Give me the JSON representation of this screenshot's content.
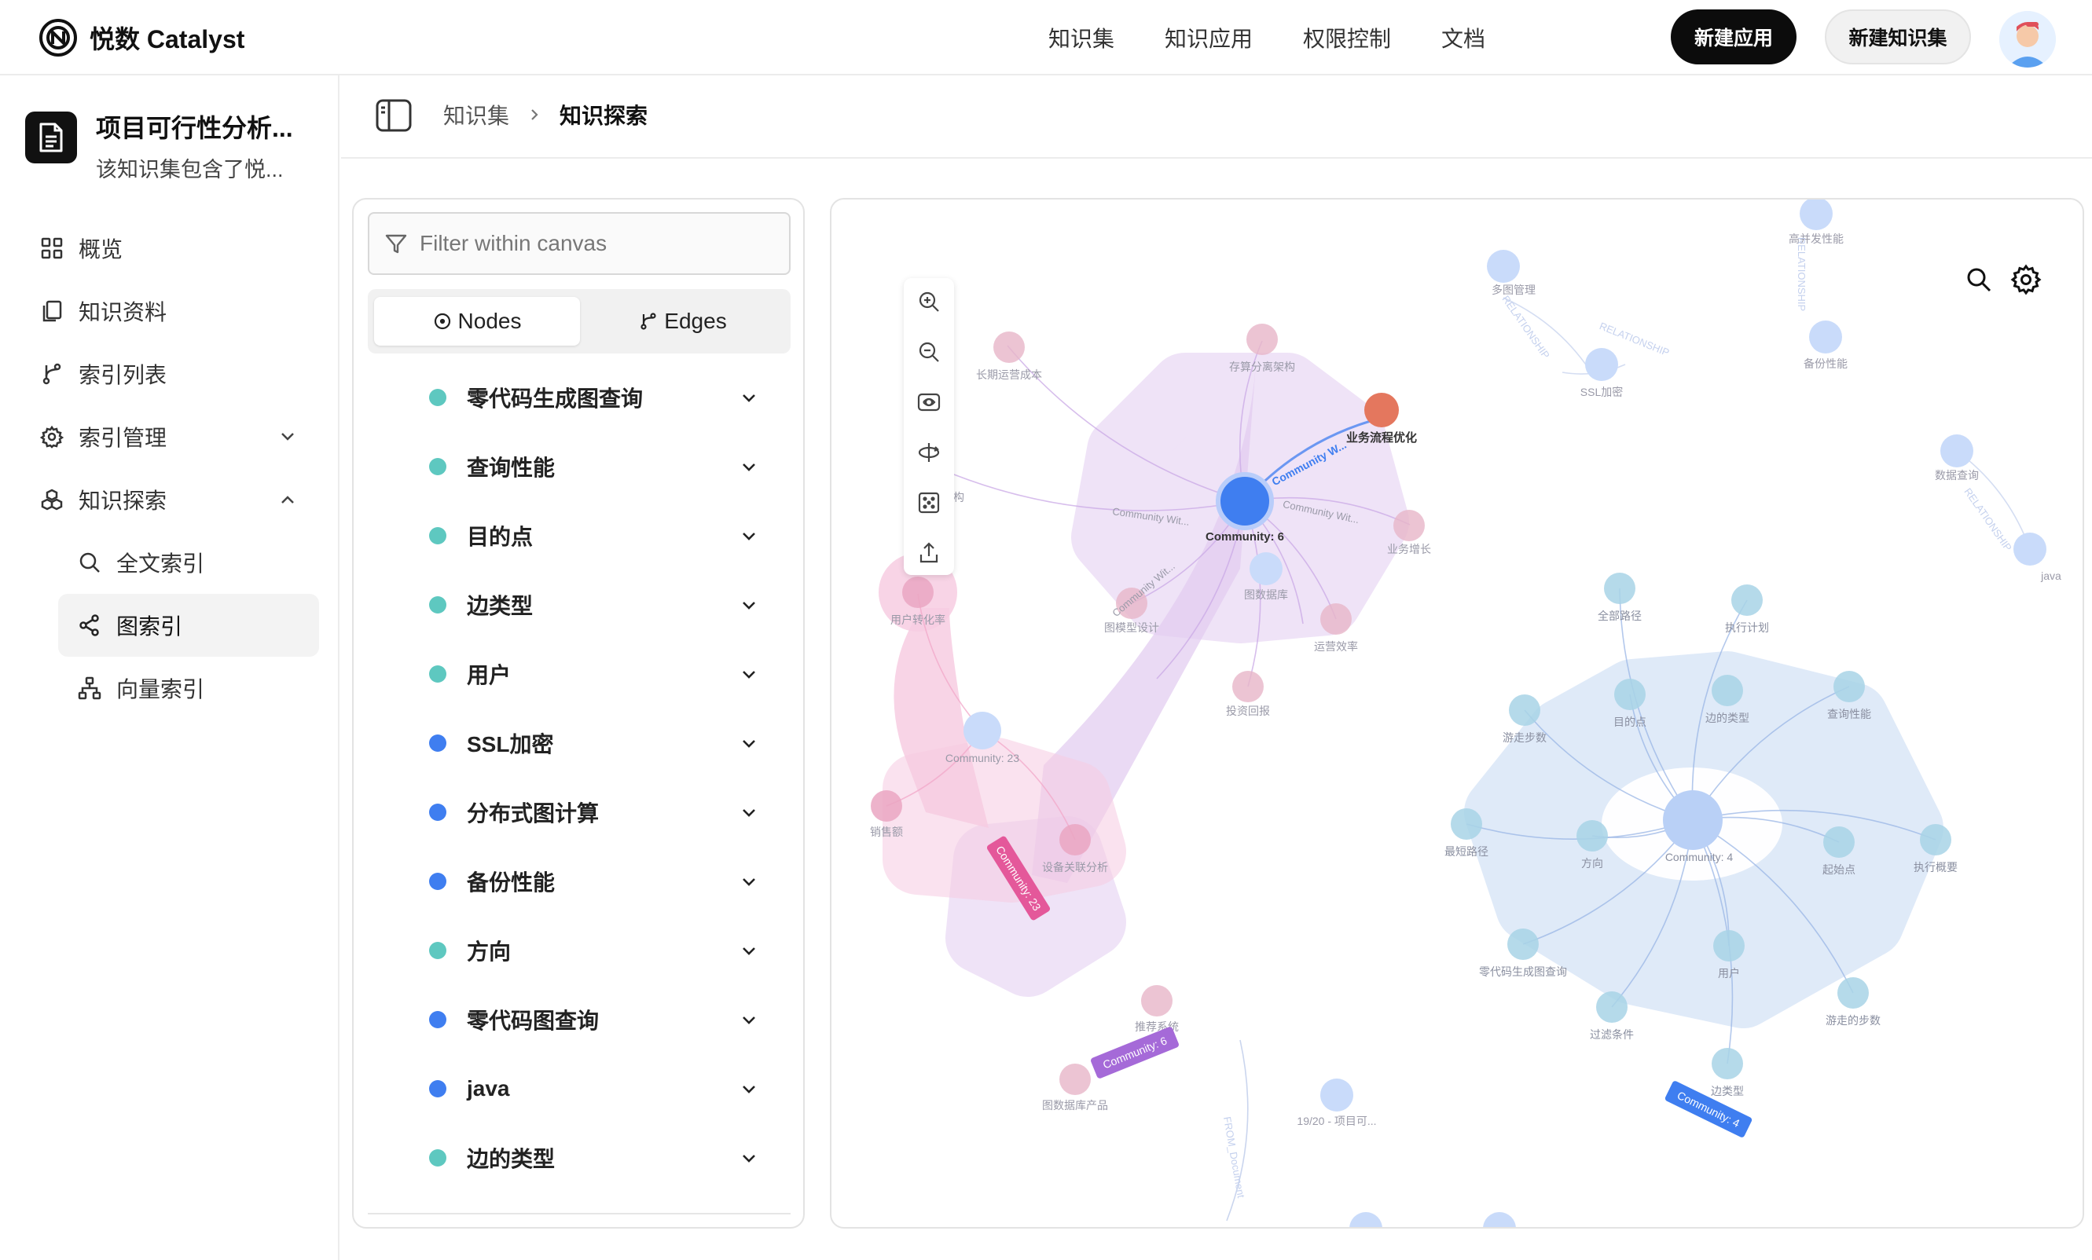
{
  "header": {
    "brand": "悦数 Catalyst",
    "nav": [
      "知识集",
      "知识应用",
      "权限控制",
      "文档"
    ],
    "new_app": "新建应用",
    "new_kb": "新建知识集"
  },
  "sidebar": {
    "kb_title": "项目可行性分析...",
    "kb_desc": "该知识集包含了悦...",
    "items": [
      {
        "label": "概览",
        "icon": "grid-icon"
      },
      {
        "label": "知识资料",
        "icon": "copy-icon"
      },
      {
        "label": "索引列表",
        "icon": "branch-icon"
      },
      {
        "label": "索引管理",
        "icon": "gear-icon"
      },
      {
        "label": "知识探索",
        "icon": "boxes-icon"
      },
      {
        "label": "全文索引",
        "icon": "search-icon"
      },
      {
        "label": "图索引",
        "icon": "share-icon"
      },
      {
        "label": "向量索引",
        "icon": "network-icon"
      }
    ]
  },
  "breadcrumb": [
    "知识集",
    "知识探索"
  ],
  "filter": {
    "placeholder": "Filter within canvas",
    "tab_nodes": "Nodes",
    "tab_edges": "Edges",
    "nodes": [
      {
        "label": "零代码生成图查询",
        "color": "#5ec8c0"
      },
      {
        "label": "查询性能",
        "color": "#5ec8c0"
      },
      {
        "label": "目的点",
        "color": "#5ec8c0"
      },
      {
        "label": "边类型",
        "color": "#5ec8c0"
      },
      {
        "label": "用户",
        "color": "#5ec8c0"
      },
      {
        "label": "SSL加密",
        "color": "#3f7ef0"
      },
      {
        "label": "分布式图计算",
        "color": "#3f7ef0"
      },
      {
        "label": "备份性能",
        "color": "#3f7ef0"
      },
      {
        "label": "方向",
        "color": "#5ec8c0"
      },
      {
        "label": "零代码图查询",
        "color": "#3f7ef0"
      },
      {
        "label": "java",
        "color": "#3f7ef0"
      },
      {
        "label": "边的类型",
        "color": "#5ec8c0"
      }
    ]
  },
  "graph": {
    "community6": {
      "badge": "Community: 6",
      "center": "Community: 6",
      "nodes": [
        "长期运营成本",
        "存算分离架构",
        "业务流程优化",
        "分布式架构",
        "业务增长",
        "图模型设计",
        "运营效率",
        "投资回报",
        "推荐系统",
        "图数据库产品"
      ],
      "edge_label": "Community W...",
      "edge_faint": "Community Wit..."
    },
    "community23": {
      "badge": "Community: 23",
      "center": "Community: 23",
      "nodes": [
        "用户转化率",
        "销售额",
        "设备关联分析"
      ]
    },
    "community4": {
      "badge": "Community: 4",
      "center": "Community: 4",
      "nodes": [
        "全部路径",
        "执行计划",
        "游走步数",
        "目的点",
        "边的类型",
        "查询性能",
        "最短路径",
        "方向",
        "起始点",
        "执行概要",
        "零代码生成图查询",
        "用户",
        "过滤条件",
        "游走的步数",
        "边类型"
      ]
    },
    "loose": [
      "多图管理",
      "高并发性能",
      "SSL加密",
      "备份性能",
      "数据查询",
      "java",
      "图数据库",
      "19/20 - 项目可..."
    ],
    "rel": "RELATIONSHIP",
    "doc": "FROM_Document"
  }
}
